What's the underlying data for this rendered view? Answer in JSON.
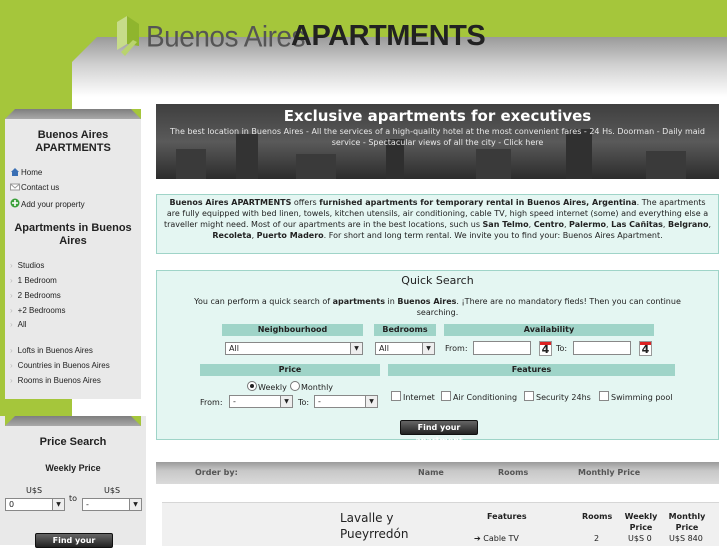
{
  "header": {
    "logo_text1": "Buenos Aires",
    "logo_text2": "APARTMENTS"
  },
  "sidebar": {
    "title": "Buenos Aires APARTMENTS",
    "links": [
      {
        "label": "Home",
        "icon": "home-icon"
      },
      {
        "label": "Contact us",
        "icon": "envelope-icon"
      },
      {
        "label": "Add your property",
        "icon": "plus-icon"
      }
    ],
    "apartments_title": "Apartments in Buenos Aires",
    "bedroom_items": [
      "Studios",
      "1 Bedroom",
      "2 Bedrooms",
      "+2 Bedrooms",
      "All"
    ],
    "other_items": [
      "Lofts in Buenos Aires",
      "Countries in Buenos Aires",
      "Rooms in Buenos Aires"
    ]
  },
  "price_search": {
    "title": "Price Search",
    "subtitle": "Weekly Price",
    "currency1": "U$S",
    "currency2": "U$S",
    "to": "to",
    "from_value": "0",
    "to_value": "-",
    "button": "Find your apartment"
  },
  "hero": {
    "title": "Exclusive apartments for executives",
    "subtitle": "The best location in Buenos Aires - All the services of a high-quality hotel at the most convenient fares - 24 Hs. Doorman - Daily maid service - Spectacular views of all the city - Click here"
  },
  "intro": {
    "b1": "Buenos Aires APARTMENTS",
    "t1": " offers ",
    "b2": "furnished apartments for temporary rental in Buenos Aires, Argentina",
    "t2": ". The apartments are fully equipped with bed linen, towels, kitchen utensils, air conditioning, cable TV, high speed internet (some) and everything else a traveller might need. Most of our apartments are in the best locations, such us ",
    "b3": "San Telmo",
    "t3": ", ",
    "b4": "Centro",
    "t4": ", ",
    "b5": "Palermo",
    "t5": ", ",
    "b6": "Las Cañitas",
    "t6": ", ",
    "b7": "Belgrano",
    "t7": ", ",
    "b8": "Recoleta",
    "t8": ", ",
    "b9": "Puerto Madero",
    "t9": ". For short and long term rental. We invite you to find your: Buenos Aires Apartment."
  },
  "quick_search": {
    "title": "Quick Search",
    "desc_pre": "You can perform a quick search of ",
    "desc_b1": "apartments",
    "desc_mid": " in ",
    "desc_b2": "Buenos Aires",
    "desc_post": ". ¡There are no mandatory fieds! Then you can continue searching.",
    "neighbourhood_label": "Neighbourhood",
    "neighbourhood_value": "All",
    "bedrooms_label": "Bedrooms",
    "bedrooms_value": "All",
    "availability_label": "Availability",
    "from_label": "From:",
    "to_label": "To:",
    "calendar_day": "4",
    "price_label": "Price",
    "weekly": "Weekly",
    "monthly": "Monthly",
    "price_from_label": "From:",
    "price_from_value": "-",
    "price_to_label": "To:",
    "price_to_value": "-",
    "features_label": "Features",
    "features": [
      "Internet",
      "Air Conditioning",
      "Security 24hs",
      "Swimming pool"
    ],
    "button": "Find your apartment"
  },
  "order_bar": {
    "order_by": "Order by:",
    "name": "Name",
    "rooms": "Rooms",
    "monthly_price": "Monthly Price"
  },
  "result": {
    "name": "Lavalle y Pueyrredón",
    "features_header": "Features",
    "rooms_header": "Rooms",
    "weekly_header": "Weekly Price",
    "monthly_header": "Monthly Price",
    "feature1": "Cable TV",
    "rooms": "2",
    "weekly": "U$S 0",
    "monthly": "U$S 840"
  },
  "colors": {
    "brand_green": "#a5c63b",
    "panel_teal": "#e4f6f2",
    "header_teal": "#9fd4c8"
  }
}
